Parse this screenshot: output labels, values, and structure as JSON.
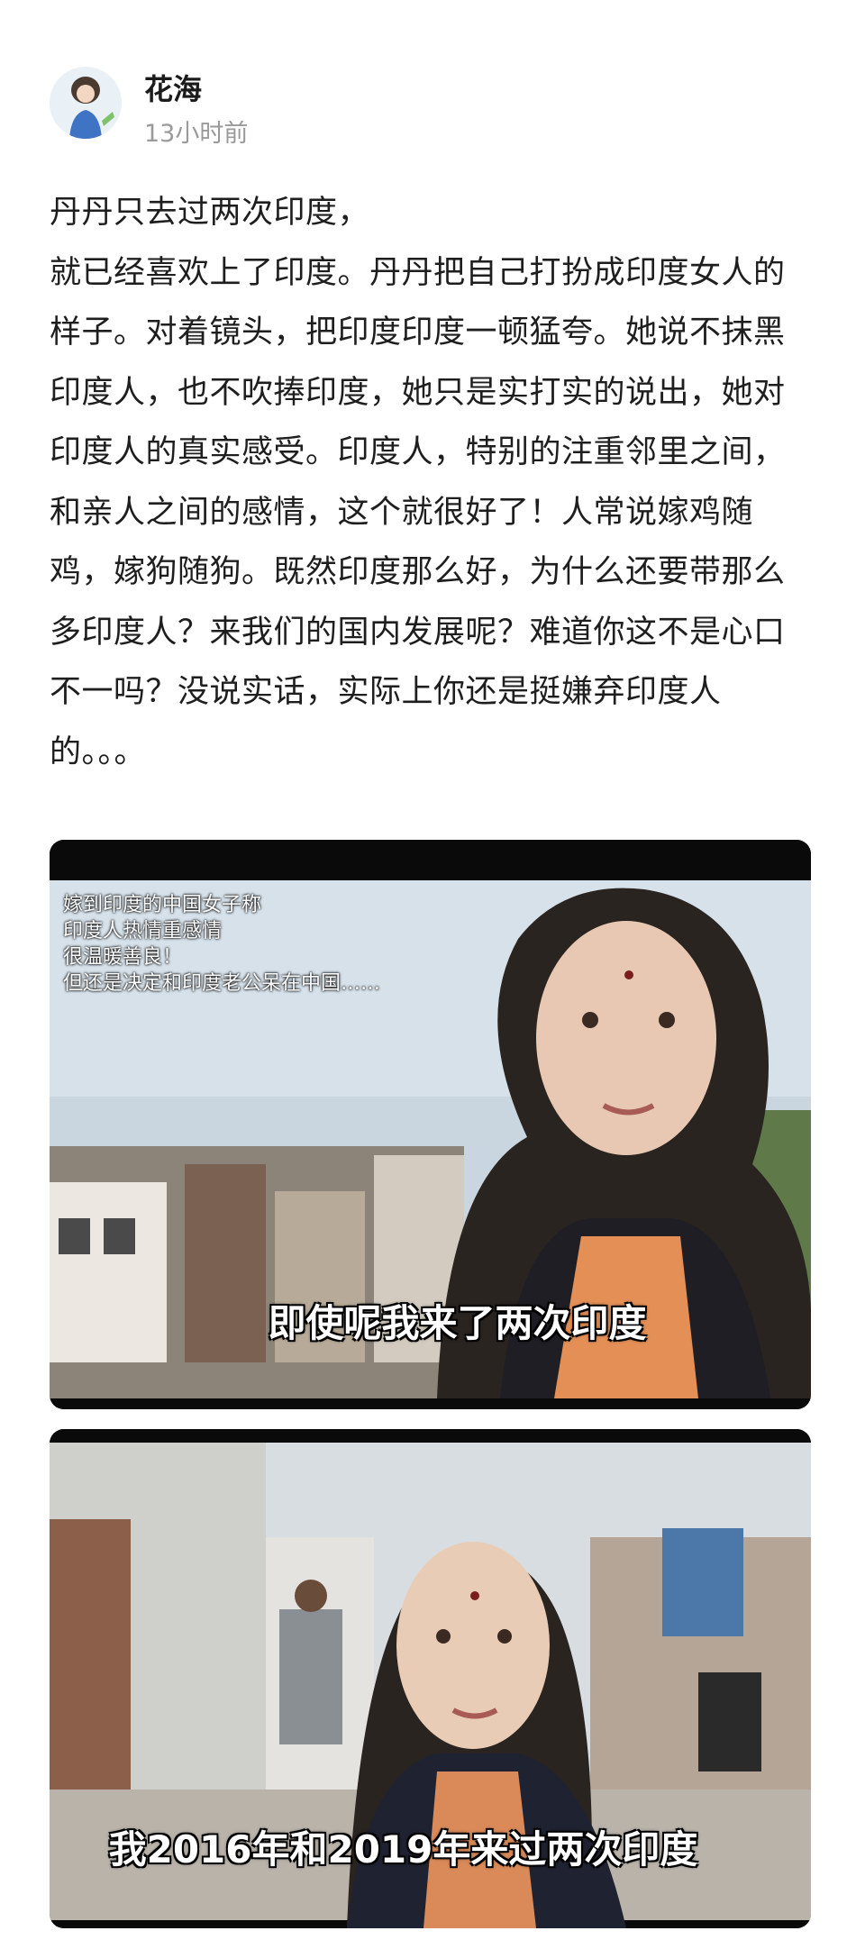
{
  "author": {
    "name": "花海",
    "time": "13小时前",
    "avatar_icon": "avatar-illustration"
  },
  "post": {
    "paragraphs": [
      "丹丹只去过两次印度，",
      "就已经喜欢上了印度。丹丹把自己打扮成印度女人的样子。对着镜头，把印度印度一顿猛夸。她说不抹黑印度人，也不吹捧印度，她只是实打实的说出，她对印度人的真实感受。印度人，特别的注重邻里之间，和亲人之间的感情，这个就很好了！人常说嫁鸡随鸡，嫁狗随狗。既然印度那么好，为什么还要带那么多印度人？来我们的国内发展呢？难道你这不是心口不一吗？没说实话，实际上你还是挺嫌弃印度人的。。。"
    ]
  },
  "media": [
    {
      "overlay_lines": [
        "嫁到印度的中国女子称",
        "印度人热情重感情",
        "很温暖善良！",
        "但还是决定和印度老公呆在中国……"
      ],
      "subtitle": "即使呢我来了两次印度"
    },
    {
      "subtitle": "我2016年和2019年来过两次印度"
    }
  ]
}
